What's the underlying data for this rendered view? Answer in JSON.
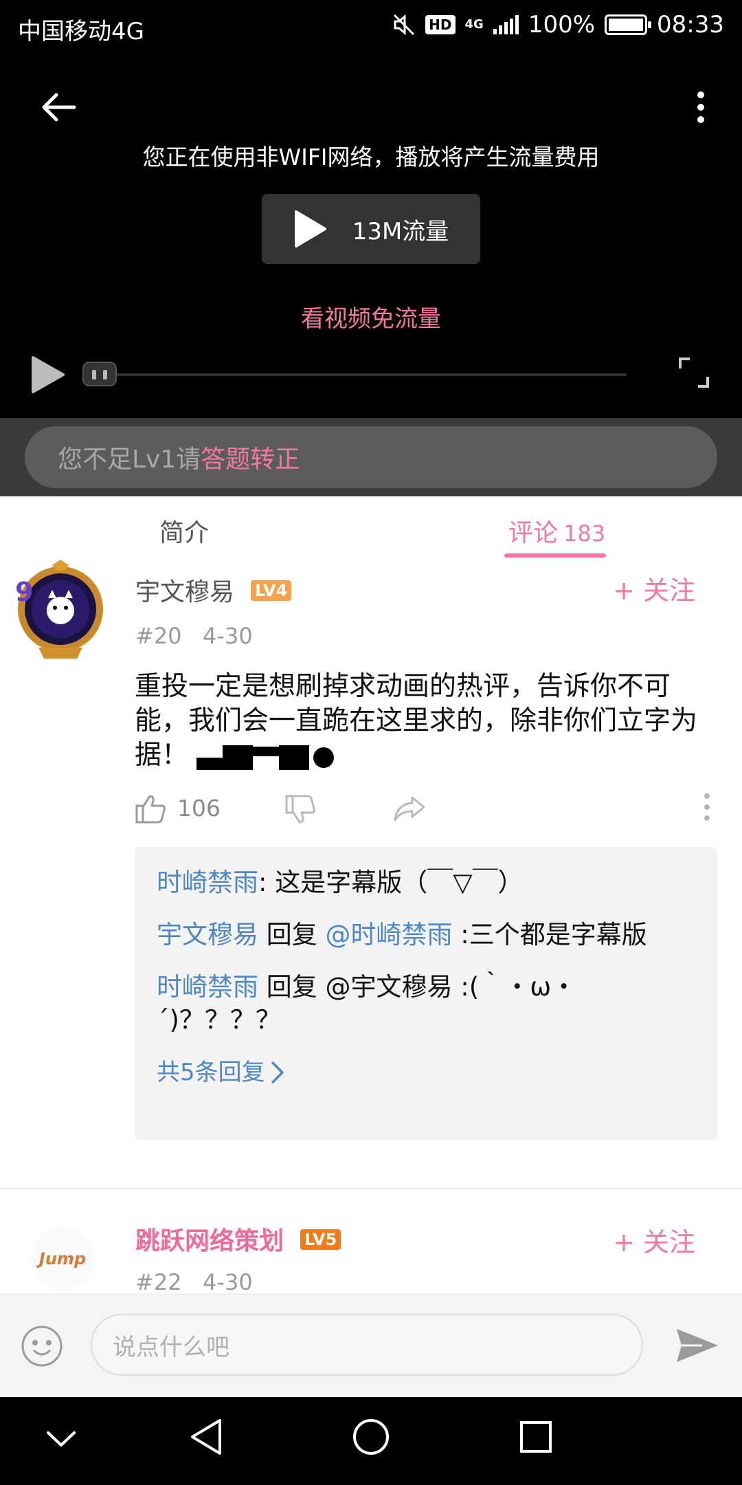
{
  "status_bar": {
    "carrier": "中国移动4G",
    "hd": "HD",
    "network": "4G",
    "battery": "100%",
    "time": "08:33"
  },
  "video": {
    "notice": "您正在使用非WIFI网络，播放将产生流量费用",
    "play_data_label": "13M流量",
    "free_data_link": "看视频免流量",
    "progress": 0
  },
  "danmaku": {
    "prefix": "您不足Lv1请",
    "link": "答题转正"
  },
  "tabs": {
    "intro": "简介",
    "comments": "评论",
    "comments_count": "183"
  },
  "comment1": {
    "username": "宇文穆易",
    "level": "LV4",
    "level_color": "#f7a14a",
    "follow": "+ 关注",
    "floor": "#20",
    "date": "4-30",
    "text": "重投一定是想刷掉求动画的热评，告诉你不可能，我们会一直跪在这里求的，除非你们立字为据！",
    "likes": "106",
    "replies": [
      {
        "author": "时崎禁雨",
        "text": ": 这是字幕版（￣▽￣）"
      },
      {
        "author": "宇文穆易",
        "reply_word": " 回复 ",
        "mention": "@时崎禁雨",
        "text": " :三个都是字幕版"
      },
      {
        "author": "时崎禁雨",
        "reply_word": " 回复 ",
        "mention_plain": "@宇文穆易",
        "text": " :(｀・ω・´)？？？？"
      }
    ],
    "more_replies": "共5条回复"
  },
  "comment2": {
    "username": "跳跃网络策划",
    "level": "LV5",
    "level_color": "#f27a1a",
    "avatar_text": "Jump",
    "follow": "+ 关注",
    "floor": "#22",
    "date": "4-30"
  },
  "input": {
    "placeholder": "说点什么吧"
  },
  "colors": {
    "accent": "#f27aa0",
    "link_blue": "#4d87c4"
  }
}
